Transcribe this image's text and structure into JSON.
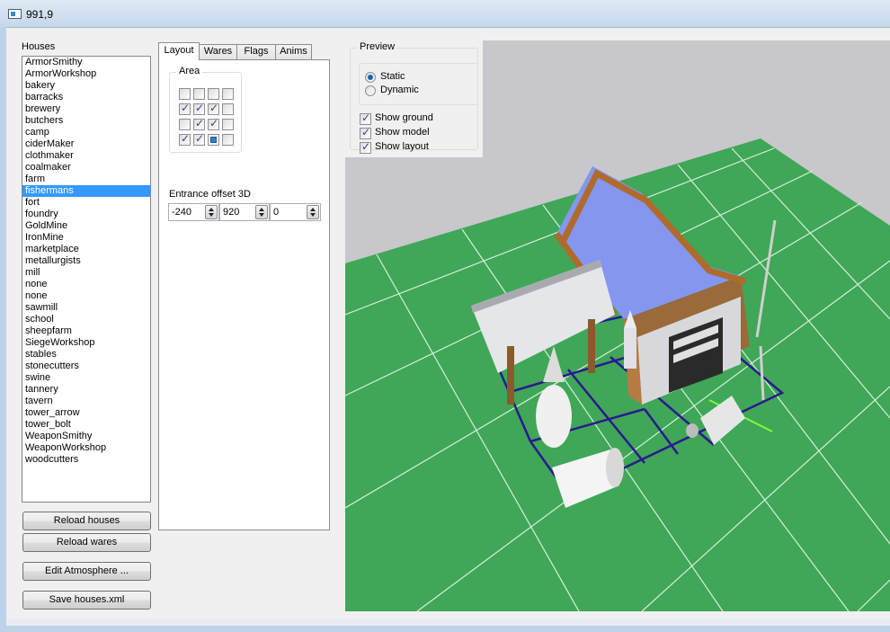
{
  "window": {
    "title": "991,9"
  },
  "houses": {
    "label": "Houses",
    "selected_index": 11,
    "items": [
      "ArmorSmithy",
      "ArmorWorkshop",
      "bakery",
      "barracks",
      "brewery",
      "butchers",
      "camp",
      "ciderMaker",
      "clothmaker",
      "coalmaker",
      "farm",
      "fishermans",
      "fort",
      "foundry",
      "GoldMine",
      "IronMine",
      "marketplace",
      "metallurgists",
      "mill",
      "none",
      "none",
      "sawmill",
      "school",
      "sheepfarm",
      "SiegeWorkshop",
      "stables",
      "stonecutters",
      "swine",
      "tannery",
      "tavern",
      "tower_arrow",
      "tower_bolt",
      "WeaponSmithy",
      "WeaponWorkshop",
      "woodcutters"
    ]
  },
  "buttons": {
    "reload_houses": "Reload houses",
    "reload_wares": "Reload wares",
    "edit_atmosphere": "Edit Atmosphere ...",
    "save_houses": "Save houses.xml"
  },
  "tabs": [
    "Layout",
    "Wares",
    "Flags",
    "Anims"
  ],
  "active_tab": "Layout",
  "layout": {
    "area_label": "Area",
    "grid": [
      [
        false,
        false,
        false,
        false
      ],
      [
        true,
        true,
        true,
        false
      ],
      [
        false,
        true,
        true,
        false
      ],
      [
        true,
        true,
        "entrance",
        false
      ]
    ],
    "entrance_label": "Entrance offset 3D",
    "entrance_values": [
      "-240",
      "920",
      "0"
    ]
  },
  "preview": {
    "label": "Preview",
    "mode_options": [
      {
        "label": "Static",
        "selected": true
      },
      {
        "label": "Dynamic",
        "selected": false
      }
    ],
    "toggles": [
      {
        "label": "Show ground",
        "checked": true
      },
      {
        "label": "Show model",
        "checked": true
      },
      {
        "label": "Show layout",
        "checked": true
      }
    ]
  },
  "colors": {
    "ground": "#3fa757",
    "grid_lines": "#d9eedd",
    "sky": "#c7c7cc",
    "roof": "#8496ee",
    "layout_outline": "#2a1a8e",
    "selection": "#3399ff"
  }
}
